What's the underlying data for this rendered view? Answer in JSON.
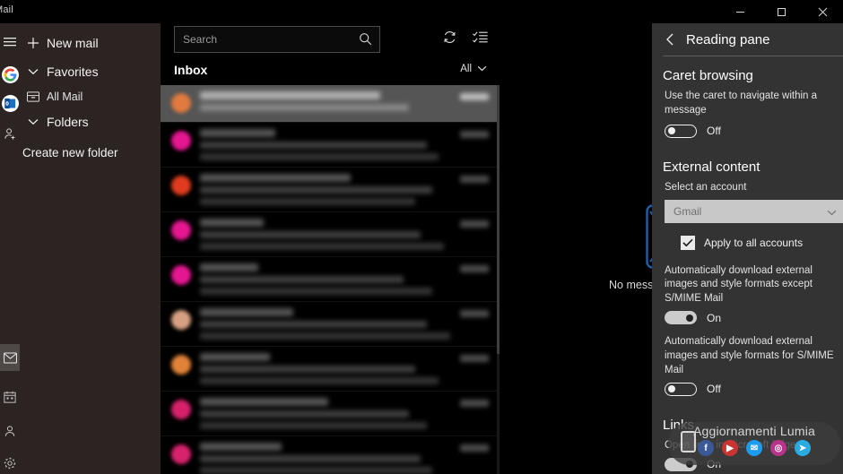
{
  "window": {
    "app_title": "Mail",
    "minimize_label": "Minimize",
    "maximize_label": "Maximize",
    "close_label": "Close"
  },
  "rail": {
    "items": [
      {
        "name": "hamburger",
        "icon": "hamburger-icon",
        "label": "Navigation"
      },
      {
        "name": "account-google",
        "icon": "google-avatar",
        "label": "G"
      },
      {
        "name": "account-outlook",
        "icon": "outlook-avatar",
        "label": "O"
      },
      {
        "name": "add-account",
        "icon": "add-person-icon",
        "label": "Add account"
      }
    ],
    "bottom_items": [
      {
        "name": "mail",
        "icon": "mail-icon",
        "label": "Mail",
        "selected": true
      },
      {
        "name": "calendar",
        "icon": "calendar-icon",
        "label": "Calendar",
        "selected": false
      },
      {
        "name": "people",
        "icon": "people-icon",
        "label": "People",
        "selected": false
      },
      {
        "name": "settings",
        "icon": "gear-icon",
        "label": "Settings",
        "selected": false
      }
    ]
  },
  "nav": {
    "new_mail": "New mail",
    "favorites": "Favorites",
    "all_mail": "All Mail",
    "folders": "Folders",
    "create_new_folder": "Create new folder"
  },
  "list": {
    "search_placeholder": "Search",
    "inbox_label": "Inbox",
    "filter_label": "All",
    "sync_label": "Sync this view",
    "selection_label": "Enter selection mode",
    "messages": [
      {
        "avatar_color": "#e07a3f",
        "selected": true,
        "w_sender": 62,
        "w_subj": 72,
        "w_prev": 0
      },
      {
        "avatar_color": "#e5168f",
        "selected": false,
        "w_sender": 26,
        "w_subj": 78,
        "w_prev": 82
      },
      {
        "avatar_color": "#e03b1e",
        "selected": false,
        "w_sender": 52,
        "w_subj": 80,
        "w_prev": 74
      },
      {
        "avatar_color": "#e5168f",
        "selected": false,
        "w_sender": 22,
        "w_subj": 76,
        "w_prev": 84
      },
      {
        "avatar_color": "#e5168f",
        "selected": false,
        "w_sender": 20,
        "w_subj": 70,
        "w_prev": 80
      },
      {
        "avatar_color": "#d8a083",
        "selected": false,
        "w_sender": 32,
        "w_subj": 78,
        "w_prev": 86
      },
      {
        "avatar_color": "#e08238",
        "selected": false,
        "w_sender": 24,
        "w_subj": 74,
        "w_prev": 82
      },
      {
        "avatar_color": "#d6216a",
        "selected": false,
        "w_sender": 44,
        "w_subj": 72,
        "w_prev": 78
      },
      {
        "avatar_color": "#d8226c",
        "selected": false,
        "w_sender": 28,
        "w_subj": 76,
        "w_prev": 80
      }
    ]
  },
  "reading": {
    "empty_message": "No message selected"
  },
  "settings": {
    "back_label": "Back",
    "title": "Reading pane",
    "caret": {
      "heading": "Caret browsing",
      "description": "Use the caret to navigate within a message",
      "toggle_state": "Off",
      "toggle_on": false
    },
    "external": {
      "heading": "External content",
      "select_label": "Select an account",
      "account_value": "Gmail",
      "apply_all_label": "Apply to all accounts",
      "apply_all_checked": true,
      "auto_download_label": "Automatically download external images and style formats except S/MIME Mail",
      "auto_download_state": "On",
      "auto_download_on": true,
      "smime_label": "Automatically download external images and style formats for S/MIME Mail",
      "smime_state": "Off",
      "smime_on": false
    },
    "links": {
      "heading": "Links",
      "edge_label": "Open links in Microsoft Edge",
      "edge_state": "On",
      "edge_on": true
    }
  },
  "watermark": {
    "text": "Aggiornamenti Lumia",
    "icons": [
      {
        "name": "facebook-icon",
        "glyph": "f",
        "color": "#3b5998"
      },
      {
        "name": "youtube-icon",
        "glyph": "▶",
        "color": "#cc3434"
      },
      {
        "name": "twitter-icon",
        "glyph": "✉",
        "color": "#1d9bf0"
      },
      {
        "name": "instagram-icon",
        "glyph": "◎",
        "color": "#b8348a"
      },
      {
        "name": "telegram-icon",
        "glyph": "➤",
        "color": "#2aabe2"
      }
    ]
  },
  "colors": {
    "nav_bg": "#2b2422",
    "flyout_bg": "#333333",
    "app_bg": "#000000",
    "accent_blue": "#1d4f8c"
  }
}
